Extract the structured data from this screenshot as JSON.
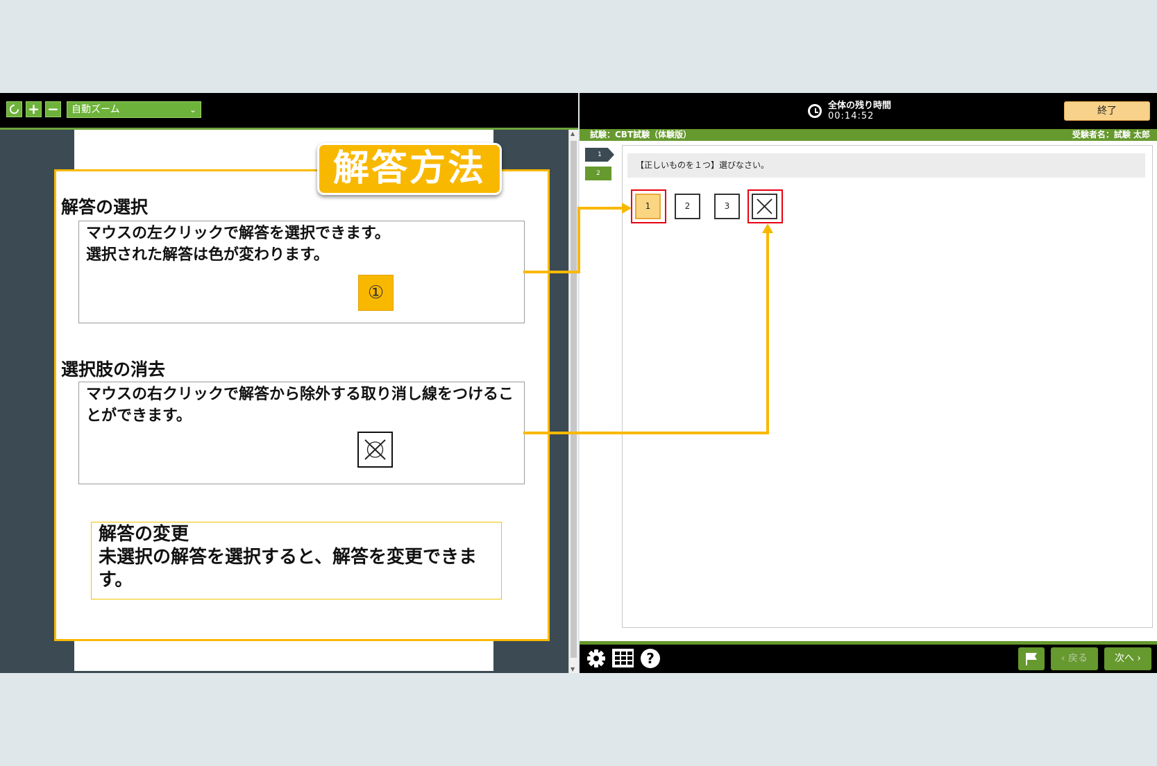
{
  "viewer": {
    "zoom_label": "自動ズーム",
    "zoom_chevron": "⌄",
    "zoom_in": "+",
    "zoom_out": "−"
  },
  "guide": {
    "title": "解答方法",
    "section1": {
      "heading": "解答の選択",
      "text": "マウスの左クリックで解答を選択できます。\n選択された解答は色が変わります。",
      "badge": "①"
    },
    "section2": {
      "heading": "選択肢の消去",
      "text": "マウスの右クリックで解答から除外する取り消し線をつけることができます。"
    },
    "section3": {
      "text": "解答の変更\n未選択の解答を選択すると、解答を変更できます。"
    }
  },
  "exam": {
    "timer_label": "全体の残り時間",
    "timer_value": "00:14:52",
    "end_button": "終了",
    "exam_name": "試験：CBT試験（体験版）",
    "examinee": "受験者名：試験 太郎",
    "question_tabs": [
      "1",
      "2"
    ],
    "question_text": "【正しいものを１つ】選びなさい。",
    "choices": [
      "1",
      "2",
      "3"
    ],
    "back_button": "戻る",
    "next_button": "次へ",
    "help_label": "?"
  },
  "colors": {
    "accent_yellow": "#f9b800",
    "brand_green": "#66992e",
    "highlight_red": "#e60012",
    "selected_choice": "#fbd682"
  }
}
